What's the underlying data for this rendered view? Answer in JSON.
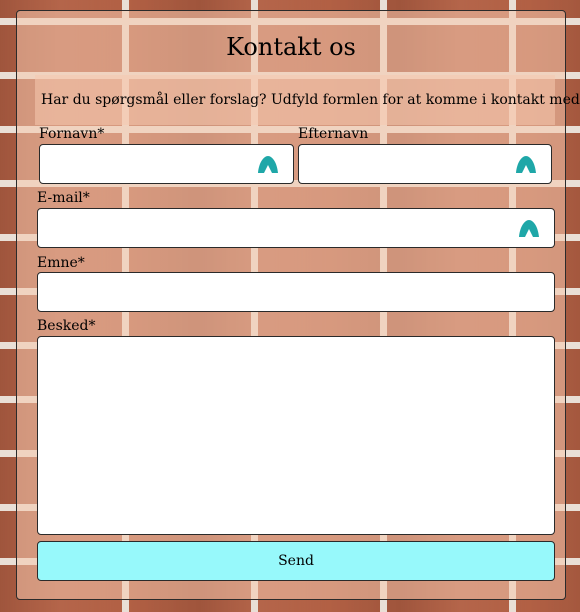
{
  "form": {
    "title": "Kontakt os",
    "intro": "Har du spørgsmål eller forslag? Udfyld formlen for at komme i kontakt med os.",
    "fields": {
      "first_name": {
        "label": "Fornavn*",
        "value": ""
      },
      "last_name": {
        "label": "Efternavn",
        "value": ""
      },
      "email": {
        "label": "E-mail*",
        "value": ""
      },
      "subject": {
        "label": "Emne*",
        "value": ""
      },
      "message": {
        "label": "Besked*",
        "value": ""
      }
    },
    "submit_label": "Send"
  },
  "colors": {
    "submit_bg": "#97f9fb",
    "autofill_icon": "#1fa7a8",
    "brick": "#b4654a",
    "mortar": "#e9dfd6"
  },
  "icons": {
    "autofill": "password-manager-icon"
  }
}
